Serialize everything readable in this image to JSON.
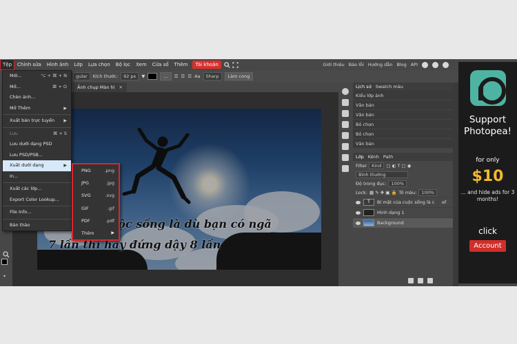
{
  "menubar": {
    "items": [
      "Tệp",
      "Chỉnh sửa",
      "Hình ảnh",
      "Lớp",
      "Lựa chọn",
      "Bộ lọc",
      "Xem",
      "Cửa sổ",
      "Thêm",
      "Tài khoản"
    ],
    "right_links": [
      "Giới thiệu",
      "Báo lỗi",
      "Hướng dẫn",
      "Blog",
      "API"
    ]
  },
  "options_bar": {
    "font_label": "gular",
    "size_label": "Kích thước:",
    "size_value": "92 px",
    "aa_label": "Aa",
    "aa_value": "Sharp",
    "warp_label": "Làm cong"
  },
  "tabs": [
    {
      "label": "Ảnh chụp Màn hì"
    }
  ],
  "file_menu": {
    "items": [
      {
        "label": "Mới...",
        "shortcut": "⌥ + ⌘ + N"
      },
      {
        "label": "Mở...",
        "shortcut": "⌘ + O"
      },
      {
        "label": "Chèn ảnh..."
      },
      {
        "label": "Mở Thêm",
        "arrow": "▶"
      },
      {
        "label": "Xuất bản trực tuyến",
        "arrow": "▶"
      },
      {
        "label": "Lưu",
        "shortcut": "⌘ + S"
      },
      {
        "label": "Lưu dưới dạng PSD"
      },
      {
        "label": "Lưu PSD/PSB..."
      },
      {
        "label": "Xuất dưới dạng",
        "arrow": "▶"
      },
      {
        "label": "In..."
      },
      {
        "label": "Xuất các lớp..."
      },
      {
        "label": "Export Color Lookup..."
      },
      {
        "label": "File Info..."
      },
      {
        "label": "Bản thảo"
      }
    ]
  },
  "export_submenu": {
    "items": [
      {
        "label": "PNG",
        "ext": ".png"
      },
      {
        "label": "JPG",
        "ext": ".jpg"
      },
      {
        "label": "SVG",
        "ext": ".svg"
      },
      {
        "label": "GIF",
        "ext": ".gif"
      },
      {
        "label": "PDF",
        "ext": ".pdf"
      },
      {
        "label": "Thêm",
        "arrow": "▶"
      }
    ]
  },
  "canvas": {
    "caption_line1": "cuộc sống là dù bạn có ngã",
    "caption_line2": "7 lần thì hãy đứng dậy 8 lần"
  },
  "history_panel": {
    "tabs": [
      "Lịch sử",
      "Swatch màu"
    ],
    "rows": [
      "Kiểu lớp ảnh",
      "Văn bản",
      "Văn bản",
      "Bỏ chọn",
      "Bỏ chọn",
      "Văn bản"
    ]
  },
  "layers_panel": {
    "tabs": [
      "Lớp",
      "Kênh",
      "Path"
    ],
    "filter_label": "Filter",
    "filter_value": "Kind",
    "blend_mode": "Bình thường",
    "opacity_label": "Độ trong đục:",
    "opacity_value": "100%",
    "lock_label": "Lock:",
    "fill_label": "Tô màu:",
    "fill_value": "100%",
    "layers": [
      {
        "name": "Bí mật của cuộc sống là c",
        "thumb": "T",
        "suffix": "ef"
      },
      {
        "name": "Hình dạng 1"
      },
      {
        "name": "Background"
      }
    ]
  },
  "ad": {
    "title": "Support Photopea!",
    "for_only": "for only",
    "price": "$10",
    "tagline": "... and hide ads for 3 months!",
    "click": "click",
    "account": "Account"
  }
}
